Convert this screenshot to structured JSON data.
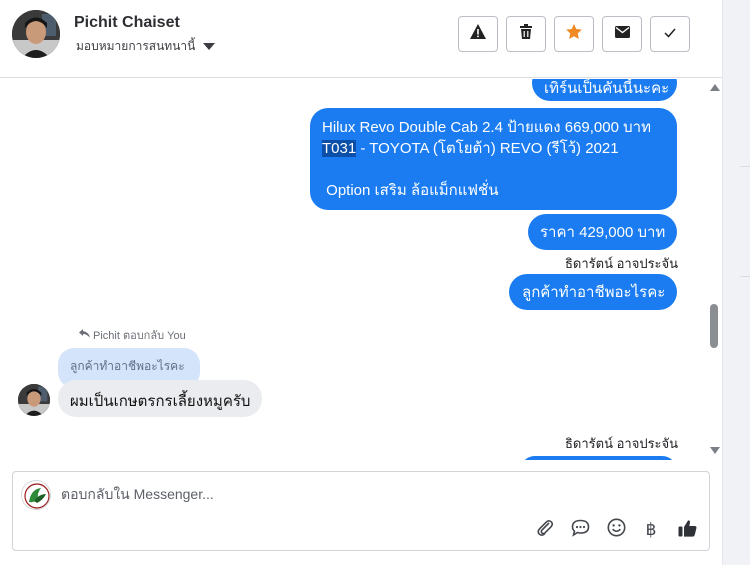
{
  "header": {
    "contact_name": "Pichit Chaiset",
    "assign_label": "มอบหมายการสนทนานี้"
  },
  "messages": {
    "partial_top": "เทิร์นเป็นคันนี้นะคะ",
    "car_line1": "Hilux Revo Double Cab 2.4 ป้ายแดง 669,000 บาท",
    "car_code": "T031",
    "car_line2_rest": " - TOYOTA (โตโยต้า) REVO (รีโว้) 2021",
    "car_option": " Option เสริม ล้อแม็กแฟชั่น",
    "price": "ราคา 429,000 บาท",
    "sender_1": "ธิดารัตน์ อาจประจัน",
    "question": "ลูกค้าทำอาชีพอะไรคะ",
    "reply_meta": "Pichit ตอบกลับ You",
    "quoted_text": "ลูกค้าทำอาชีพอะไรคะ",
    "incoming": "ผมเป็นเกษตรกรเลี้ยงหมูครับ",
    "sender_2": "ธิดารัตน์ อาจประจัน"
  },
  "composer": {
    "placeholder": "ตอบกลับใน Messenger...",
    "currency_symbol": "฿"
  },
  "icons": {
    "tools": [
      "alert-icon",
      "trash-icon",
      "star-icon",
      "mail-icon",
      "check-icon"
    ],
    "composer": [
      "attach-icon",
      "chat-bubble-icon",
      "emoji-icon",
      "baht-icon",
      "like-icon"
    ]
  },
  "colors": {
    "outgoing_bubble": "#1a7cf0",
    "incoming_bubble": "#eaecef",
    "quoted_bubble": "#d4e4fb",
    "star": "#f08a24"
  }
}
